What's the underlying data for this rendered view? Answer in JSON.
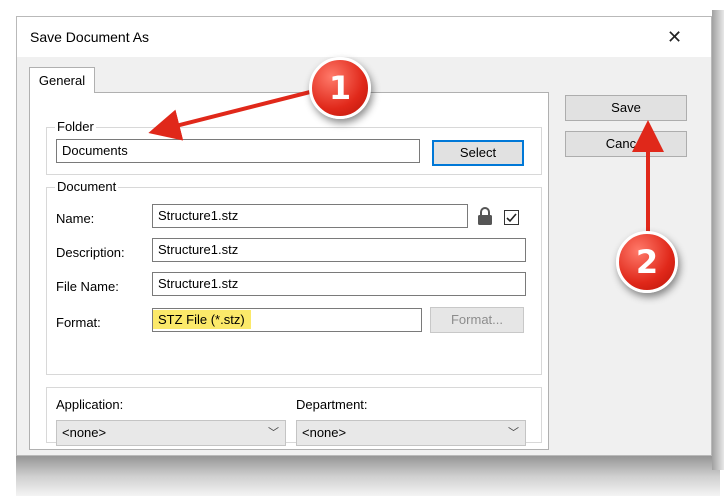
{
  "dialog": {
    "title": "Save Document As",
    "close_glyph": "✕"
  },
  "tabs": [
    {
      "label": "General"
    }
  ],
  "folder": {
    "group_label": "Folder",
    "value": "Documents",
    "select_label": "Select"
  },
  "document": {
    "group_label": "Document",
    "name_label": "Name:",
    "name_value": "Structure1.stz",
    "name_locked": true,
    "name_checked": true,
    "description_label": "Description:",
    "description_value": "Structure1.stz",
    "filename_label": "File Name:",
    "filename_value": "Structure1.stz",
    "format_label": "Format:",
    "format_value": "STZ File (*.stz)",
    "format_button_label": "Format..."
  },
  "bottom": {
    "application_label": "Application:",
    "application_value": "<none>",
    "department_label": "Department:",
    "department_value": "<none>"
  },
  "side_buttons": {
    "save_label": "Save",
    "cancel_label": "Cancel"
  },
  "annotations": [
    {
      "number": "1",
      "color": "#e0281a"
    },
    {
      "number": "2",
      "color": "#e0281a"
    }
  ],
  "colors": {
    "highlight": "#fbe96a",
    "default_button_border": "#0078d7",
    "annotation_red": "#e0281a"
  }
}
